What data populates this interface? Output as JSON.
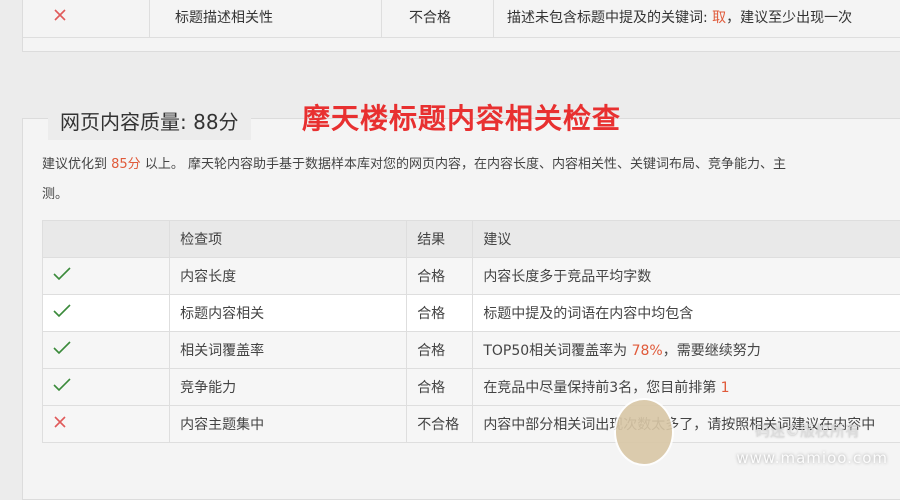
{
  "top_row": {
    "item": "标题描述相关性",
    "result": "不合格",
    "advice_prefix": "描述未包含标题中提及的关键词: ",
    "advice_keyword": "取",
    "advice_suffix": "，建议至少出现一次"
  },
  "section": {
    "legend_label": "网页内容质量:",
    "score": "88分",
    "overlay_title": "摩天楼标题内容相关检查",
    "desc_prefix": "建议优化到 ",
    "desc_target": "85分",
    "desc_suffix": " 以上。 摩天轮内容助手基于数据样本库对您的网页内容，在内容长度、内容相关性、关键词布局、竞争能力、",
    "desc_cutoff": "主",
    "desc_line2": "测。"
  },
  "table": {
    "headers": [
      "",
      "检查项",
      "结果",
      "建议"
    ],
    "rows": [
      {
        "status": "pass",
        "item": "内容长度",
        "result": "合格",
        "advice": "内容长度多于竞品平均字数"
      },
      {
        "status": "pass",
        "item": "标题内容相关",
        "result": "合格",
        "advice": "标题中提及的词语在内容中均包含"
      },
      {
        "status": "pass",
        "item": "相关词覆盖率",
        "result": "合格",
        "advice_prefix": "TOP50相关词覆盖率为 ",
        "advice_value": "78%",
        "advice_suffix": "，需要继续努力"
      },
      {
        "status": "pass",
        "item": "竞争能力",
        "result": "合格",
        "advice_prefix": "在竞品中尽量保持前3名，您目前排第 ",
        "advice_value": "1"
      },
      {
        "status": "fail",
        "item": "内容主题集中",
        "result": "不合格",
        "advice": "内容中部分相关词出现次数太多了，请按照相关词建议在内容中"
      }
    ]
  },
  "watermark": {
    "en": "www.mamioo.com",
    "cn": "码迷©版权所有"
  },
  "colors": {
    "pass": "#3a8a3a",
    "fail": "#e05a5a",
    "accent_red": "#e83030",
    "value_red": "#e05a3a"
  }
}
